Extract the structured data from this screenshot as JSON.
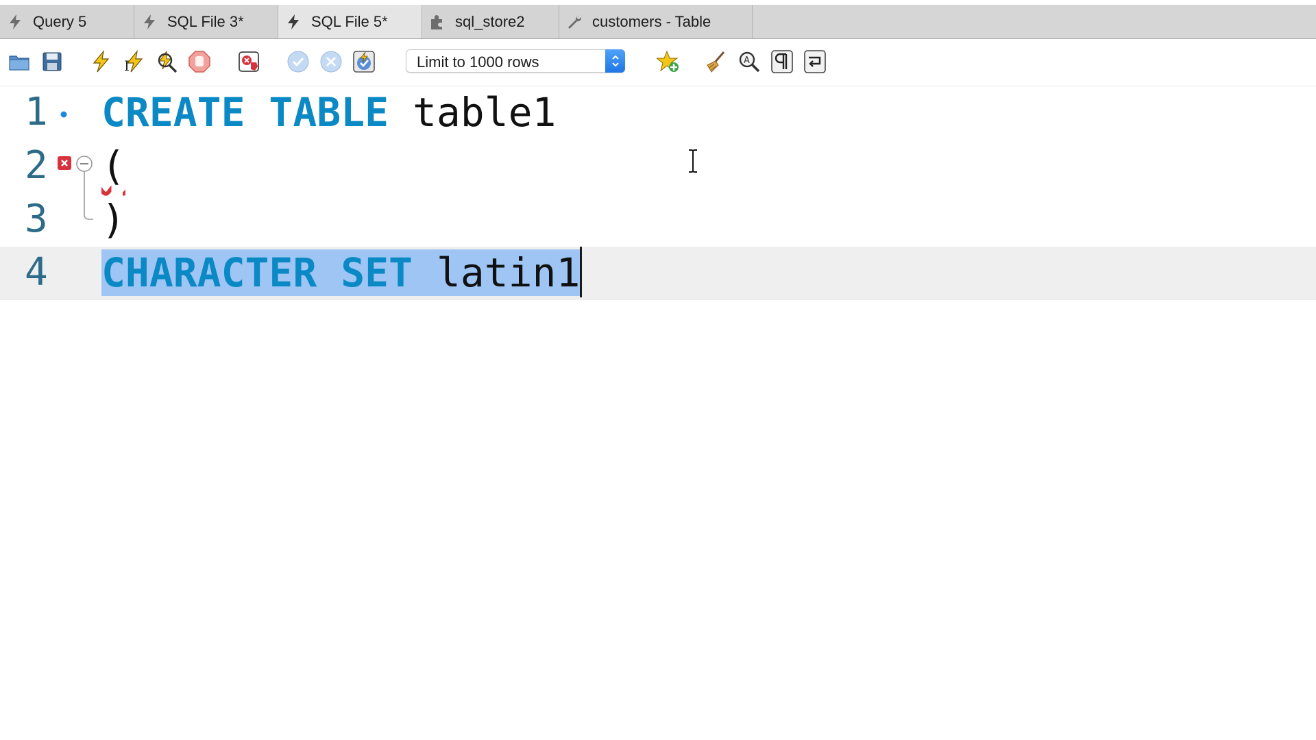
{
  "tabs": [
    {
      "label": "Query 5",
      "icon": "lightning-icon",
      "active": false
    },
    {
      "label": "SQL File 3*",
      "icon": "lightning-icon",
      "active": false
    },
    {
      "label": "SQL File 5*",
      "icon": "lightning-icon",
      "active": true
    },
    {
      "label": "sql_store2",
      "icon": "puzzle-icon",
      "active": false
    },
    {
      "label": "customers - Table",
      "icon": "wrench-icon",
      "active": false
    }
  ],
  "toolbar": {
    "buttons": [
      "open-folder-icon",
      "save-icon",
      "execute-icon",
      "execute-current-icon",
      "explain-icon",
      "stop-icon",
      "toggle-error-stop-icon",
      "commit-icon",
      "rollback-icon",
      "autocommit-icon",
      "add-snippet-icon",
      "beautify-icon",
      "find-icon",
      "invisible-chars-icon",
      "wrap-lines-icon"
    ],
    "limit_select": "Limit to 1000 rows"
  },
  "editor": {
    "lines": [
      {
        "number": "1",
        "tokens": [
          {
            "type": "kw",
            "text": "CREATE TABLE"
          },
          {
            "type": "plain",
            "text": " table1"
          }
        ],
        "marker": "statement-dot"
      },
      {
        "number": "2",
        "tokens": [
          {
            "type": "plain",
            "text": "("
          }
        ],
        "marker": "error"
      },
      {
        "number": "3",
        "tokens": [
          {
            "type": "plain",
            "text": ")"
          }
        ],
        "marker": "fold-end"
      },
      {
        "number": "4",
        "tokens": [
          {
            "type": "kw",
            "text": "CHARACTER SET"
          },
          {
            "type": "plain",
            "text": " latin1"
          }
        ],
        "marker": "none",
        "selected": true
      }
    ]
  },
  "colors": {
    "keyword": "#0a89c4",
    "line_number": "#2c6b8a",
    "selection": "#9fc5f4",
    "error": "#d8323c",
    "select_accent": "#1f76e6"
  }
}
